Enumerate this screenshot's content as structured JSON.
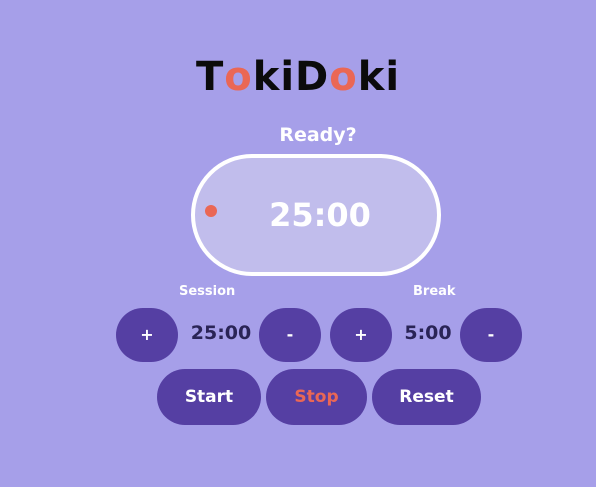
{
  "app": {
    "title_letters": [
      {
        "char": "T",
        "color": "#0b0b0b"
      },
      {
        "char": "o",
        "color": "#ea6755"
      },
      {
        "char": "k",
        "color": "#0b0b0b"
      },
      {
        "char": "i",
        "color": "#0b0b0b"
      },
      {
        "char": "D",
        "color": "#0b0b0b"
      },
      {
        "char": "o",
        "color": "#ea6755"
      },
      {
        "char": "k",
        "color": "#0b0b0b"
      },
      {
        "char": "i",
        "color": "#0b0b0b"
      }
    ],
    "status": "Ready?"
  },
  "clock": {
    "time": "25:00",
    "dot_color": "#ea6755"
  },
  "session": {
    "label": "Session",
    "increment_label": "+",
    "value": "25:00",
    "decrement_label": "-"
  },
  "break": {
    "label": "Break",
    "increment_label": "+",
    "value": "5:00",
    "decrement_label": "-"
  },
  "controls": {
    "start_label": "Start",
    "stop_label": "Stop",
    "reset_label": "Reset",
    "stop_color": "#ea6755"
  },
  "colors": {
    "background": "#a69fe9",
    "button": "#553fa3",
    "clock_fill": "#c1bdec",
    "value_text": "#2a2456"
  }
}
